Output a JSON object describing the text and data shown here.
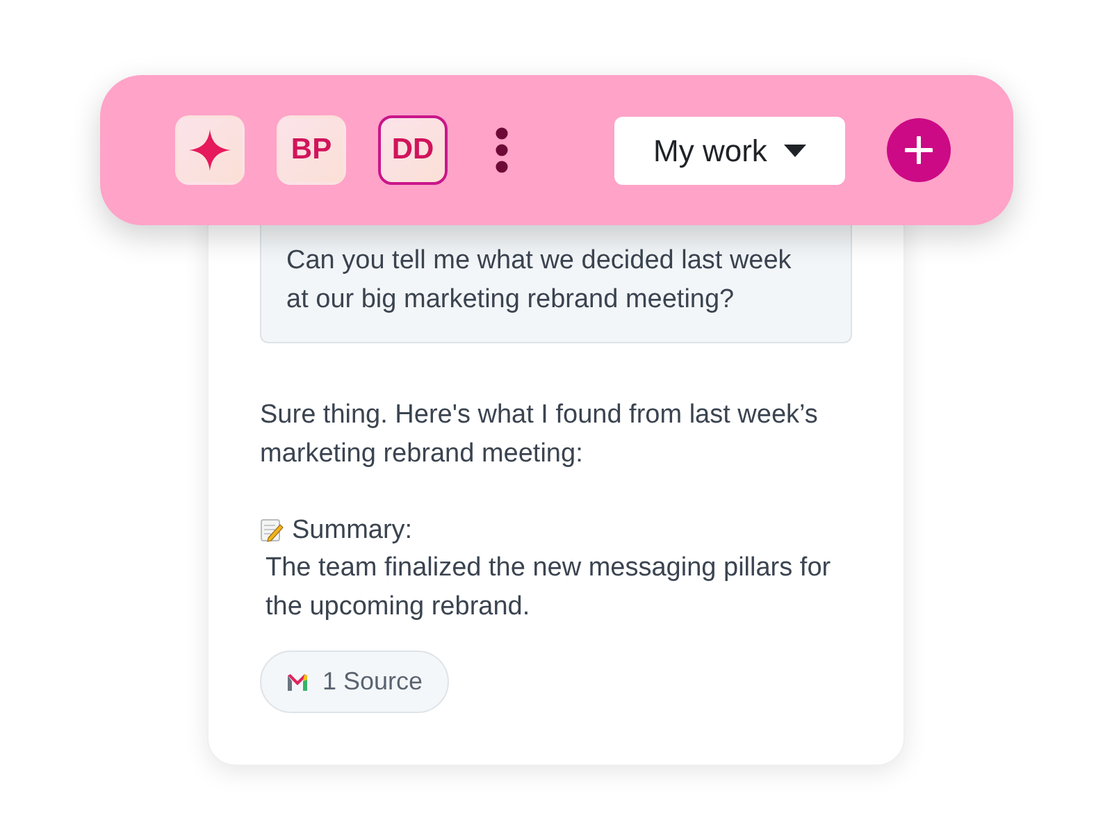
{
  "toolbar": {
    "assistants": [
      {
        "kind": "sparkle",
        "selected": false
      },
      {
        "kind": "initials",
        "label": "BP",
        "selected": false
      },
      {
        "kind": "initials",
        "label": "DD",
        "selected": true
      }
    ],
    "dropdown": {
      "label": "My work"
    }
  },
  "chat": {
    "question": "Can you tell me what we decided last week at our big marketing rebrand meeting?",
    "answer": {
      "intro": "Sure thing. Here's what I found from last week’s marketing rebrand meeting:",
      "summary_heading": "Summary:",
      "summary": "The team finalized the new messaging pillars for the upcoming rebrand.",
      "source_chip": "1 Source"
    }
  }
}
